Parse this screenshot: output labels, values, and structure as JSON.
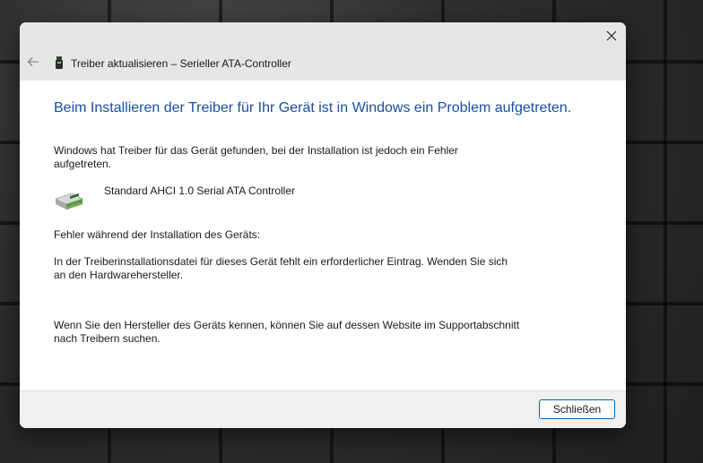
{
  "window": {
    "title": "Treiber aktualisieren – Serieller ATA-Controller"
  },
  "content": {
    "heading": "Beim Installieren der Treiber für Ihr Gerät ist in Windows ein Problem aufgetreten.",
    "intro": "Windows hat Treiber für das Gerät gefunden, bei der Installation ist jedoch ein Fehler aufgetreten.",
    "device_name": "Standard AHCI 1.0 Serial ATA Controller",
    "error_label": "Fehler während der Installation des Geräts:",
    "error_message": "In der Treiberinstallationsdatei für dieses Gerät fehlt ein erforderlicher Eintrag. Wenden Sie sich an den Hardwarehersteller.",
    "hint": "Wenn Sie den Hersteller des Geräts kennen, können Sie auf dessen Website im Supportabschnitt nach Treibern suchen."
  },
  "footer": {
    "close_label": "Schließen"
  },
  "icons": {
    "close": "close-icon",
    "back": "back-arrow-icon",
    "title": "usb-drive-icon",
    "device": "storage-controller-icon"
  },
  "colors": {
    "heading": "#1a4fa0",
    "button_border": "#0067c0",
    "titlebar": "#e6e6e6",
    "footer": "#f0f0f0"
  }
}
